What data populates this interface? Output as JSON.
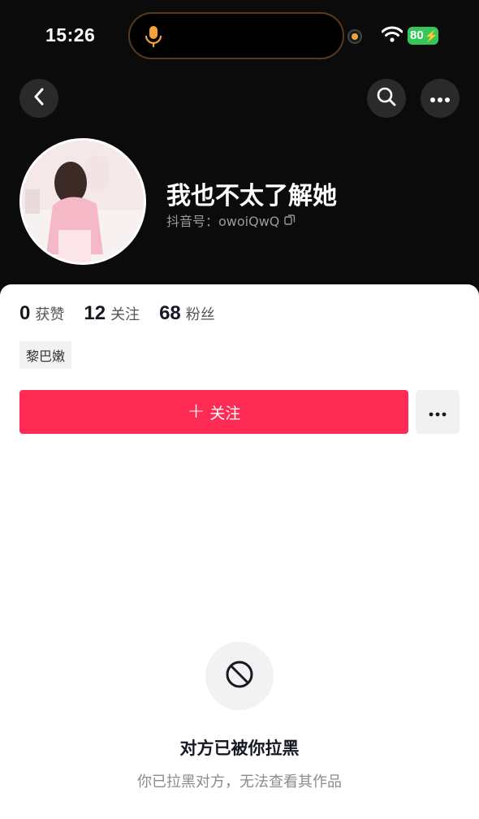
{
  "status_bar": {
    "time": "15:26",
    "battery": "80",
    "accent_mic_color": "#f2a33a",
    "battery_color": "#35c759"
  },
  "nav": {
    "back_icon": "back-arrow-icon",
    "search_icon": "search-icon",
    "more_icon": "more-dots-icon"
  },
  "profile": {
    "username": "我也不太了解她",
    "douyin_id_label": "抖音号：",
    "douyin_id": "owoiQwQ"
  },
  "stats": [
    {
      "value": "0",
      "label": "获赞"
    },
    {
      "value": "12",
      "label": "关注"
    },
    {
      "value": "68",
      "label": "粉丝"
    }
  ],
  "tag": "黎巴嫩",
  "actions": {
    "follow_label": "关注",
    "follow_plus": "+",
    "follow_color": "#fe2c55"
  },
  "blocked": {
    "icon": "blocked-icon",
    "title": "对方已被你拉黑",
    "description": "你已拉黑对方，无法查看其作品"
  }
}
